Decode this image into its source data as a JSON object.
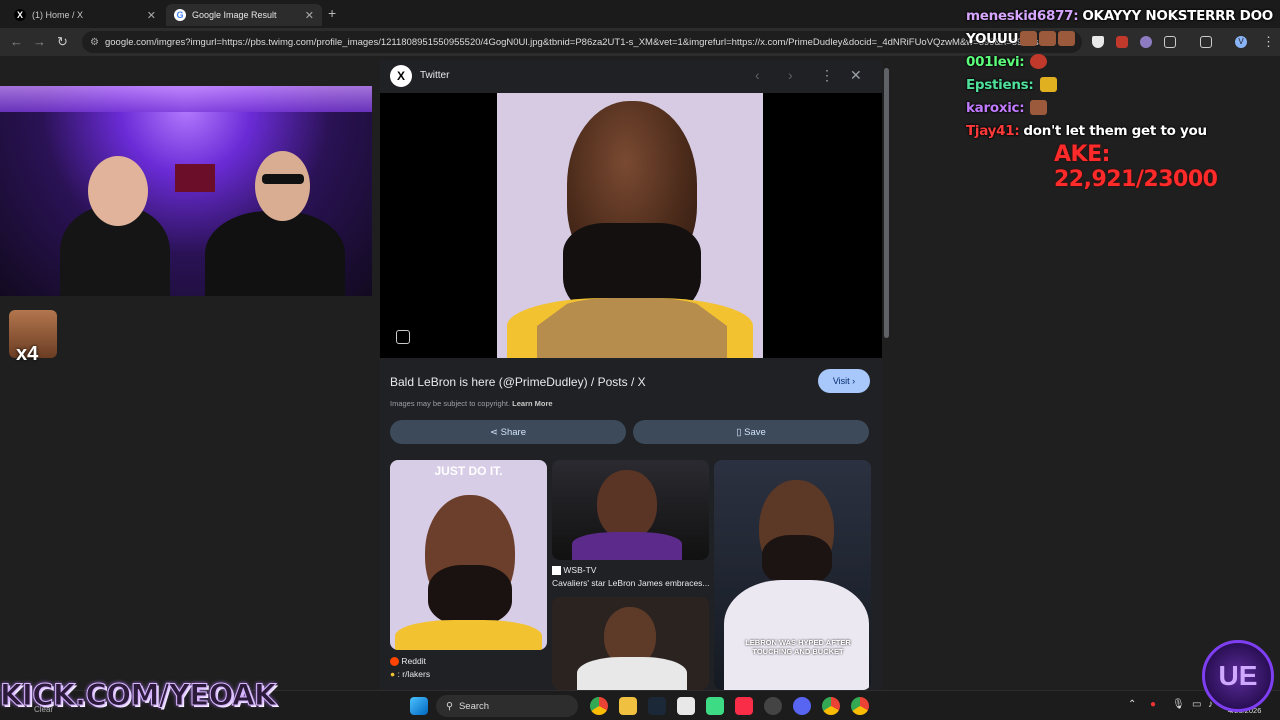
{
  "browser": {
    "tabs": [
      {
        "label": "(1) Home / X",
        "favicon": "X"
      },
      {
        "label": "Google Image Result",
        "favicon": "G"
      }
    ],
    "new_tab": "+",
    "url": "google.com/imgres?imgurl=https://pbs.twimg.com/profile_images/1211808951550955520/4GogN0Ul.jpg&tbnid=P86za2UT1-s_XM&vet=1&imgrefurl=https://x.com/PrimeDudley&docid=_4dNRiFUoVQzwM&w=399&h=399&so...",
    "profile_initial": "V"
  },
  "panel": {
    "source": "Twitter",
    "title": "Bald LeBron is here (@PrimeDudley) / Posts / X",
    "visit_label": "Visit",
    "copyright_text": "Images may be subject to copyright.",
    "learn_more": "Learn More",
    "share_label": "Share",
    "save_label": "Save",
    "related": [
      {
        "banner": "JUST DO IT.",
        "source": "Reddit",
        "caption": "r/lakers"
      },
      {
        "source": "WSB-TV",
        "caption": "Cavaliers' star LeBron James embraces..."
      },
      {
        "overlay": "LEBRON WAS HYPED AFTER TOUCHING AND BUCKET"
      }
    ]
  },
  "stream": {
    "chat": [
      {
        "user": "meneskid6877:",
        "message": "OKAYYY NOKSTERRR DOO",
        "color": "#d6a6ff"
      },
      {
        "user": "",
        "message": "YOUUU",
        "color": "#ffffff"
      },
      {
        "user": "001levi:",
        "message": "",
        "color": "#5cff7a"
      },
      {
        "user": "Epstiens:",
        "message": "",
        "color": "#4fe09b"
      },
      {
        "user": "karoxic:",
        "message": "",
        "color": "#c07bff"
      },
      {
        "user": "Tjay41:",
        "message": "don't let them get to you",
        "color": "#ff3a3a"
      }
    ],
    "goal_text": "AKE: 22,921/23000",
    "emote_count": "x4",
    "banner": "KICK.COM/YEOAK",
    "logo_text": "UE"
  },
  "taskbar": {
    "search_placeholder": "Search",
    "clear_label": "Clear",
    "date": "4/26/2026"
  }
}
